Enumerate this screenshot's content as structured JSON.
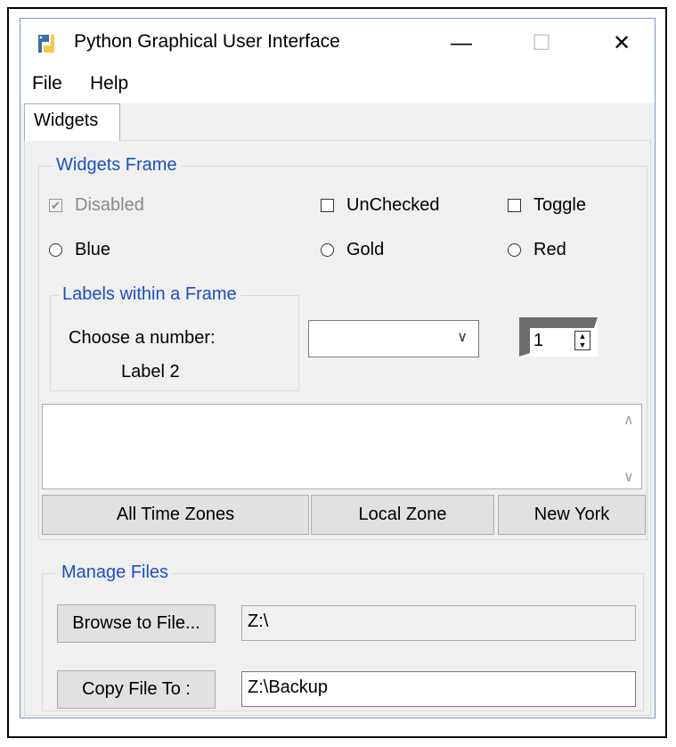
{
  "window": {
    "title": "Python Graphical User Interface",
    "minimize": "—",
    "maximize": "☐",
    "close": "✕"
  },
  "menu": {
    "file": "File",
    "help": "Help"
  },
  "tabs": [
    {
      "label": "Widgets",
      "selected": true
    }
  ],
  "widgets_frame": {
    "title": "Widgets Frame",
    "checkboxes": [
      {
        "label": "Disabled",
        "checked": true,
        "disabled": true,
        "mark": "✔"
      },
      {
        "label": "UnChecked",
        "checked": false
      },
      {
        "label": "Toggle",
        "checked": false
      }
    ],
    "radios": [
      {
        "label": "Blue",
        "selected": false
      },
      {
        "label": "Gold",
        "selected": false
      },
      {
        "label": "Red",
        "selected": false
      }
    ],
    "labels_frame": {
      "title": "Labels within a Frame",
      "choose_label": "Choose a number:",
      "label2": "Label 2"
    },
    "combobox": {
      "value": "",
      "arrow": "∨"
    },
    "spinbox": {
      "value": "1",
      "up": "▲",
      "down": "▼"
    },
    "scrolled_text": {
      "value": "",
      "up": "∧",
      "down": "∨"
    },
    "buttons": {
      "all_zones": "All Time Zones",
      "local_zone": "Local Zone",
      "new_york": "New York"
    }
  },
  "manage_files": {
    "title": "Manage Files",
    "browse_button": "Browse to File...",
    "browse_entry": "Z:\\",
    "copy_button": "Copy File To :",
    "copy_entry": "Z:\\Backup"
  },
  "colors": {
    "accent": "#1a4fc4",
    "window_border": "#7a96c9",
    "background": "#f0f0f0"
  }
}
